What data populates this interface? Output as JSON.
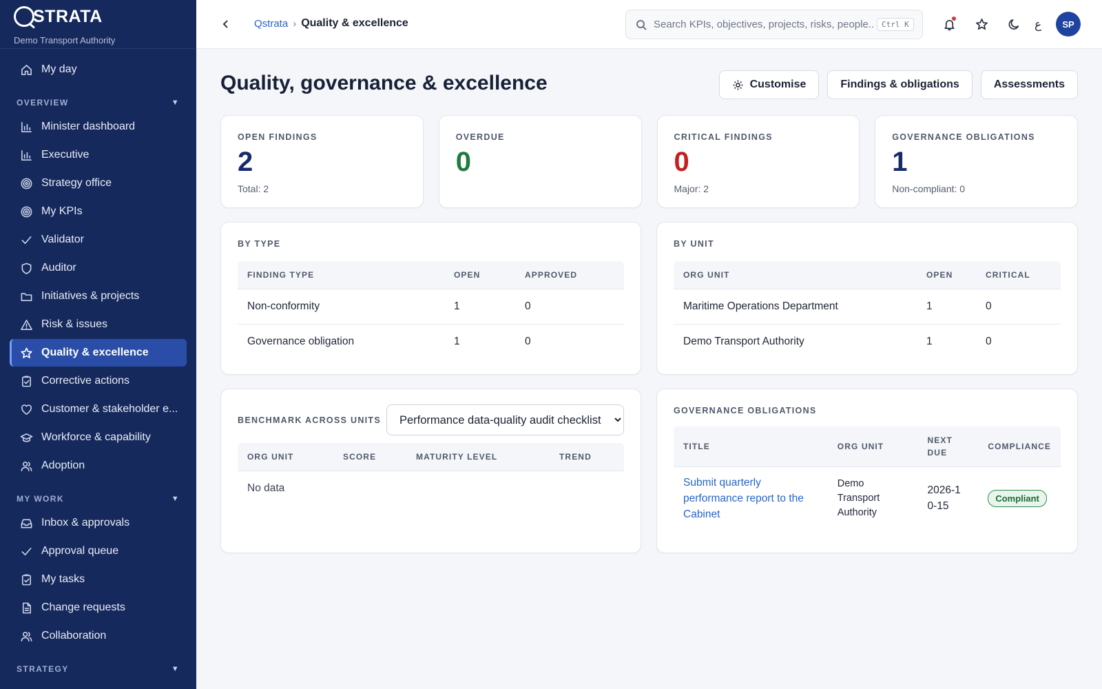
{
  "brand": {
    "logo": "QSTRATA",
    "org": "Demo Transport Authority"
  },
  "sidebar": {
    "top": [
      {
        "label": "My day",
        "icon": "home-icon"
      }
    ],
    "sections": [
      {
        "title": "OVERVIEW",
        "items": [
          {
            "label": "Minister dashboard",
            "icon": "bar-chart-icon"
          },
          {
            "label": "Executive",
            "icon": "bar-chart-icon"
          },
          {
            "label": "Strategy office",
            "icon": "target-icon"
          },
          {
            "label": "My KPIs",
            "icon": "target-icon"
          },
          {
            "label": "Validator",
            "icon": "check-icon"
          },
          {
            "label": "Auditor",
            "icon": "shield-icon"
          },
          {
            "label": "Initiatives & projects",
            "icon": "folder-icon"
          },
          {
            "label": "Risk & issues",
            "icon": "warning-icon"
          },
          {
            "label": "Quality & excellence",
            "icon": "star-icon",
            "active": true
          },
          {
            "label": "Corrective actions",
            "icon": "clipboard-check-icon"
          },
          {
            "label": "Customer & stakeholder e...",
            "icon": "heart-icon"
          },
          {
            "label": "Workforce & capability",
            "icon": "graduation-cap-icon"
          },
          {
            "label": "Adoption",
            "icon": "users-icon"
          }
        ]
      },
      {
        "title": "MY WORK",
        "items": [
          {
            "label": "Inbox & approvals",
            "icon": "inbox-icon"
          },
          {
            "label": "Approval queue",
            "icon": "check-icon"
          },
          {
            "label": "My tasks",
            "icon": "clipboard-check-icon"
          },
          {
            "label": "Change requests",
            "icon": "document-icon"
          },
          {
            "label": "Collaboration",
            "icon": "users-icon"
          }
        ]
      },
      {
        "title": "STRATEGY",
        "items": []
      }
    ]
  },
  "topbar": {
    "breadcrumb_root": "Qstrata",
    "breadcrumb_sep": "›",
    "breadcrumb_current": "Quality & excellence",
    "search_placeholder": "Search KPIs, objectives, projects, risks, people...",
    "search_shortcut": "Ctrl K",
    "lang": "ع",
    "avatar_initials": "SP"
  },
  "page": {
    "title": "Quality, governance & excellence",
    "actions": {
      "customise": "Customise",
      "findings": "Findings & obligations",
      "assessments": "Assessments"
    }
  },
  "kpis": [
    {
      "label": "OPEN FINDINGS",
      "value": "2",
      "sub": "Total: 2",
      "tone": ""
    },
    {
      "label": "OVERDUE",
      "value": "0",
      "sub": "",
      "tone": "green"
    },
    {
      "label": "CRITICAL FINDINGS",
      "value": "0",
      "sub": "Major: 2",
      "tone": "red"
    },
    {
      "label": "GOVERNANCE OBLIGATIONS",
      "value": "1",
      "sub": "Non-compliant: 0",
      "tone": ""
    }
  ],
  "by_type": {
    "title": "BY TYPE",
    "columns": [
      "FINDING TYPE",
      "OPEN",
      "APPROVED"
    ],
    "rows": [
      [
        "Non-conformity",
        "1",
        "0"
      ],
      [
        "Governance obligation",
        "1",
        "0"
      ]
    ]
  },
  "by_unit": {
    "title": "BY UNIT",
    "columns": [
      "ORG UNIT",
      "OPEN",
      "CRITICAL"
    ],
    "rows": [
      [
        "Maritime Operations Department",
        "1",
        "0"
      ],
      [
        "Demo Transport Authority",
        "1",
        "0"
      ]
    ]
  },
  "benchmark": {
    "title": "BENCHMARK ACROSS UNITS",
    "selected": "Performance data-quality audit checklist",
    "columns": [
      "ORG UNIT",
      "SCORE",
      "MATURITY LEVEL",
      "TREND"
    ],
    "empty": "No data"
  },
  "obligations": {
    "title": "GOVERNANCE OBLIGATIONS",
    "columns": [
      "TITLE",
      "ORG UNIT",
      "NEXT DUE",
      "COMPLIANCE"
    ],
    "rows": [
      {
        "title": "Submit quarterly performance report to the Cabinet",
        "org_unit": "Demo Transport Authority",
        "next_due": "2026-10-15",
        "compliance": "Compliant"
      }
    ]
  }
}
